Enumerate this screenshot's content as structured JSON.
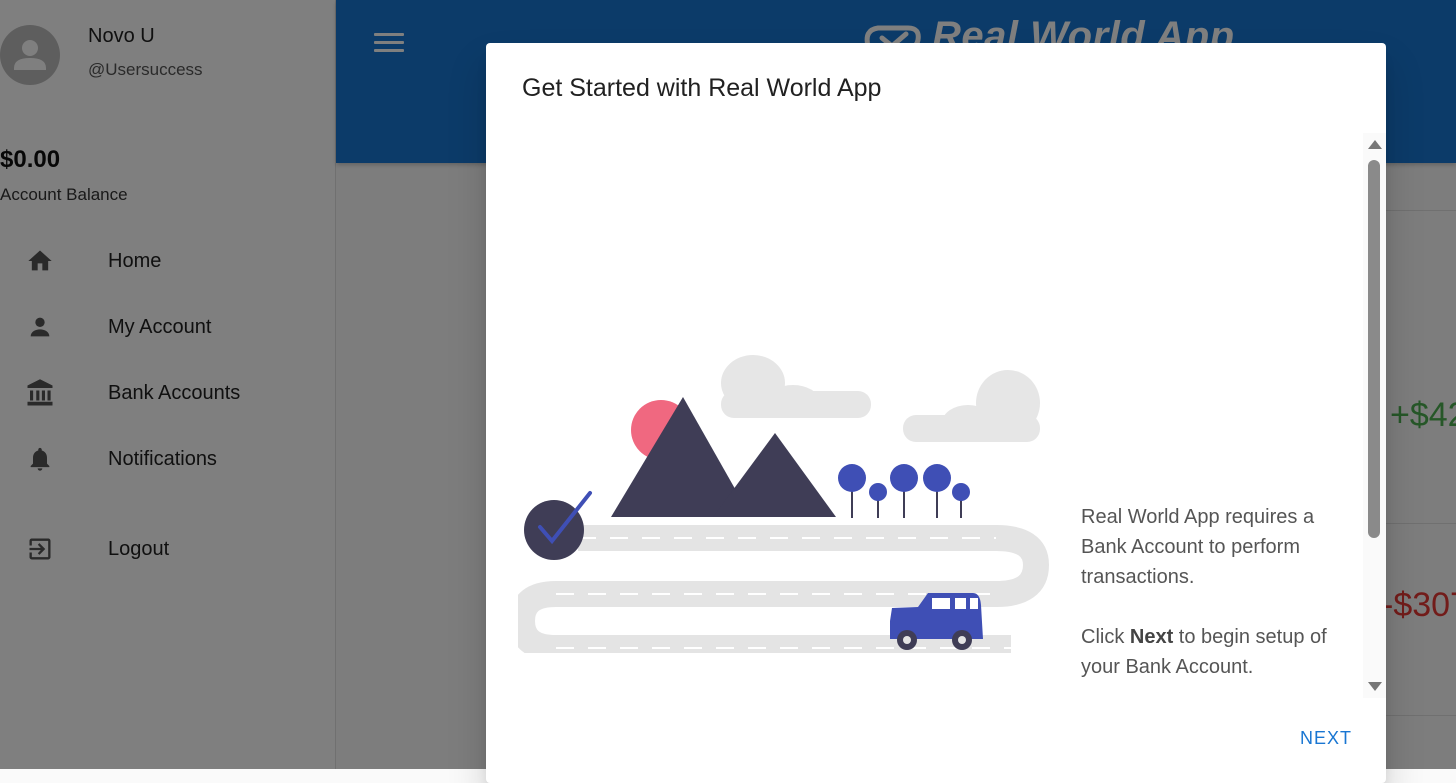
{
  "sidebar": {
    "user": {
      "name": "Novo U",
      "handle": "@Usersuccess"
    },
    "balance": {
      "amount": "$0.00",
      "label": "Account Balance"
    },
    "nav": [
      {
        "label": "Home",
        "icon": "home-icon"
      },
      {
        "label": "My Account",
        "icon": "person-icon"
      },
      {
        "label": "Bank Accounts",
        "icon": "bank-icon"
      },
      {
        "label": "Notifications",
        "icon": "bell-icon"
      },
      {
        "label": "Logout",
        "icon": "logout-icon"
      }
    ]
  },
  "appbar": {
    "title": "Real World App",
    "accent": "#1976d2"
  },
  "background": {
    "amount_positive": "+$42",
    "amount_negative": "-$307"
  },
  "dialog": {
    "title": "Get Started with Real World App",
    "text_line1": "Real World App requires a Bank Account to perform transactions.",
    "text_line2_prefix": "Click ",
    "text_line2_bold": "Next",
    "text_line2_suffix": " to begin setup of your Bank Account.",
    "next_label": "NEXT"
  }
}
